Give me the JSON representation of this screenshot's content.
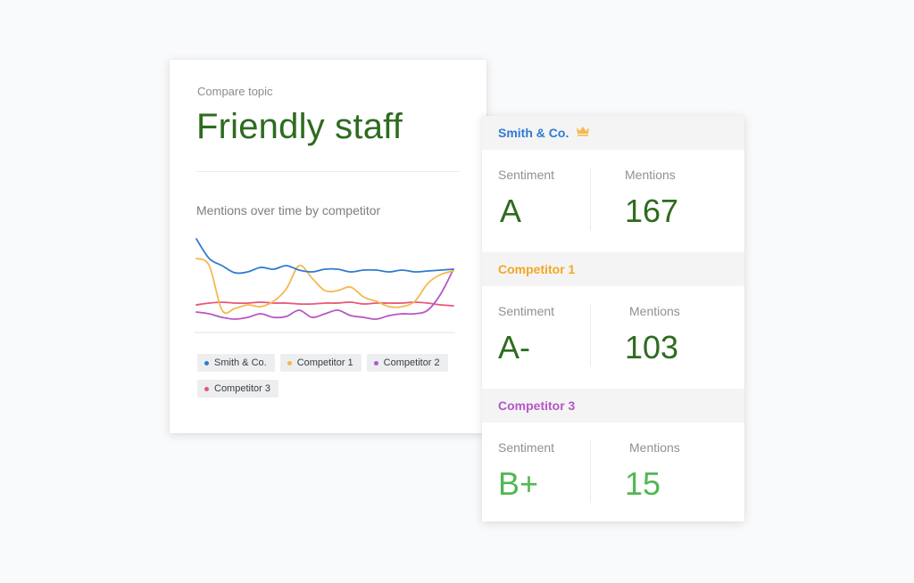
{
  "topic_card": {
    "eyebrow": "Compare topic",
    "title": "Friendly staff",
    "chart_title": "Mentions over time by competitor",
    "legend": [
      {
        "label": "Smith & Co.",
        "color": "#2f7bd0"
      },
      {
        "label": "Competitor 1",
        "color": "#f6b84e"
      },
      {
        "label": "Competitor 2",
        "color": "#b656c5"
      },
      {
        "label": "Competitor 3",
        "color": "#e8577a"
      }
    ]
  },
  "chart_data": {
    "type": "line",
    "x": [
      0,
      1,
      2,
      3,
      4,
      5,
      6,
      7,
      8,
      9,
      10,
      11,
      12,
      13,
      14,
      15,
      16,
      17,
      18,
      19,
      20
    ],
    "series": [
      {
        "name": "Smith & Co.",
        "color": "#2f7bd0",
        "values": [
          100,
          78,
          70,
          62,
          63,
          68,
          66,
          70,
          65,
          63,
          66,
          66,
          63,
          65,
          65,
          63,
          65,
          63,
          64,
          65,
          66
        ]
      },
      {
        "name": "Competitor 1",
        "color": "#f6b84e",
        "values": [
          78,
          70,
          20,
          22,
          26,
          24,
          30,
          44,
          70,
          56,
          42,
          42,
          46,
          35,
          30,
          24,
          24,
          30,
          50,
          60,
          64
        ]
      },
      {
        "name": "Competitor 2",
        "color": "#b656c5",
        "values": [
          18,
          16,
          12,
          10,
          12,
          16,
          12,
          13,
          20,
          12,
          16,
          20,
          14,
          12,
          10,
          14,
          16,
          16,
          20,
          38,
          66
        ]
      },
      {
        "name": "Competitor 3",
        "color": "#e8577a",
        "values": [
          26,
          28,
          29,
          28,
          28,
          29,
          28,
          28,
          27,
          27,
          28,
          28,
          29,
          27,
          28,
          28,
          28,
          29,
          28,
          26,
          25
        ]
      }
    ]
  },
  "scores_card": {
    "label_sentiment": "Sentiment",
    "label_mentions": "Mentions",
    "sections": [
      {
        "name": "Smith & Co.",
        "color": "#2f7bd0",
        "sentiment": "A",
        "mentions": "167",
        "value_color": "#2e6b1f",
        "icon": "crown-icon",
        "icon_color": "#f6b84e"
      },
      {
        "name": "Competitor 1",
        "color": "#f6a623",
        "sentiment": "A-",
        "mentions": "103",
        "value_color": "#2e6b1f"
      },
      {
        "name": "Competitor 3",
        "color": "#b656c5",
        "sentiment": "B+",
        "mentions": "15",
        "value_color": "#52b752"
      }
    ]
  }
}
